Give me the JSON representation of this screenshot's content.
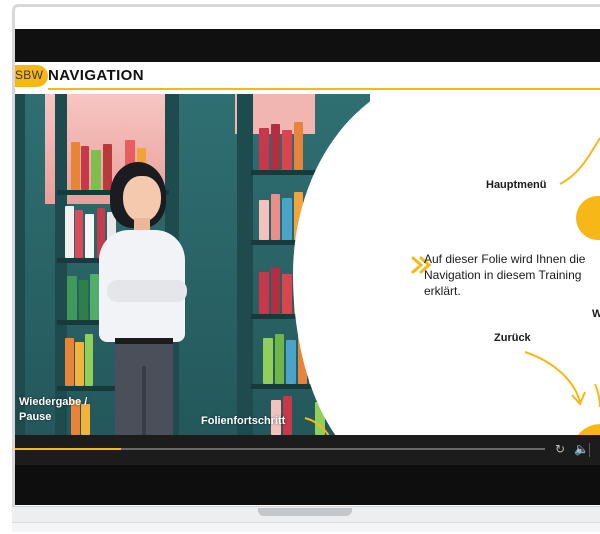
{
  "slide": {
    "logo": "SBW",
    "title": "NAVIGATION",
    "labels": {
      "hauptmenu": "Hauptmenü",
      "zurueck": "Zurück",
      "wiedergabe_line1": "Wiedergabe /",
      "wiedergabe_line2": "Pause",
      "folienfortschritt": "Folienfortschritt",
      "partial_right": "W"
    },
    "body_lines": [
      "Auf dieser Folie wird Ihnen die",
      "Navigation in diesem Training",
      "erklärt."
    ]
  },
  "player": {
    "progress": 0.2,
    "icons": [
      "reload-icon",
      "volume-icon"
    ]
  },
  "colors": {
    "accent": "#f7b817",
    "player_bg": "#1c1c1c",
    "screen_bg": "#0e0e0e"
  }
}
